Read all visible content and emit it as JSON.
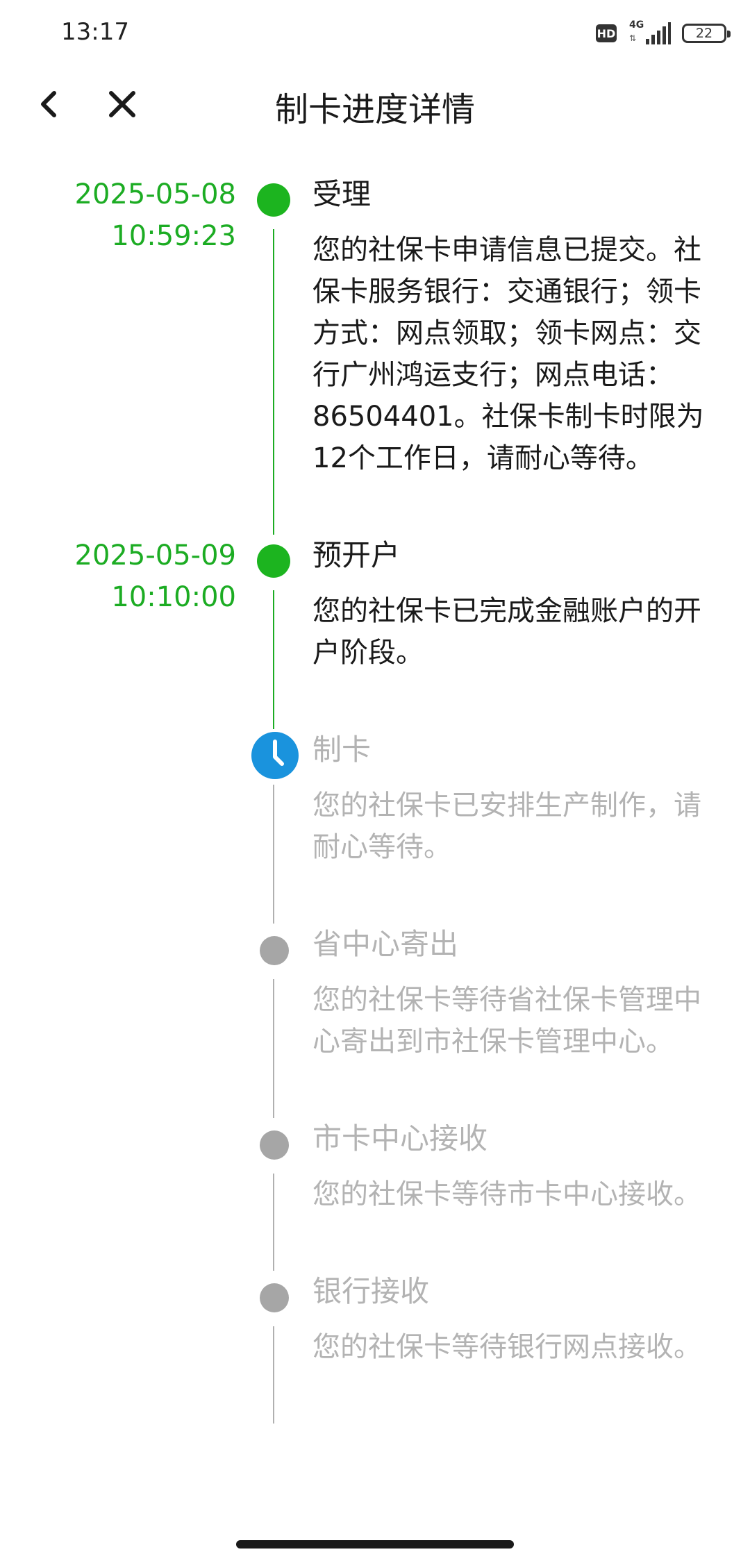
{
  "status_bar": {
    "time": "13:17",
    "hd_label": "HD",
    "network_label": "4G",
    "battery_level": "22"
  },
  "nav": {
    "title": "制卡进度详情",
    "back_icon": "chevron-left-icon",
    "close_icon": "close-icon"
  },
  "timeline": {
    "steps": [
      {
        "date": "2025-05-08",
        "time": "10:59:23",
        "title": "受理",
        "desc": "您的社保卡申请信息已提交。社保卡服务银行：交通银行；领卡方式：网点领取；领卡网点：交行广州鸿运支行；网点电话：86504401。社保卡制卡时限为12个工作日，请耐心等待。",
        "status": "done"
      },
      {
        "date": "2025-05-09",
        "time": "10:10:00",
        "title": "预开户",
        "desc": "您的社保卡已完成金融账户的开户阶段。",
        "status": "done"
      },
      {
        "date": "",
        "time": "",
        "title": "制卡",
        "desc": "您的社保卡已安排生产制作，请耐心等待。",
        "status": "current"
      },
      {
        "date": "",
        "time": "",
        "title": "省中心寄出",
        "desc": "您的社保卡等待省社保卡管理中心寄出到市社保卡管理中心。",
        "status": "pending"
      },
      {
        "date": "",
        "time": "",
        "title": "市卡中心接收",
        "desc": "您的社保卡等待市卡中心接收。",
        "status": "pending"
      },
      {
        "date": "",
        "time": "",
        "title": "银行接收",
        "desc": "您的社保卡等待银行网点接收。",
        "status": "pending"
      }
    ]
  },
  "colors": {
    "done": "#1cb41f",
    "current": "#1a93dd",
    "pending": "#a6a6a6"
  }
}
